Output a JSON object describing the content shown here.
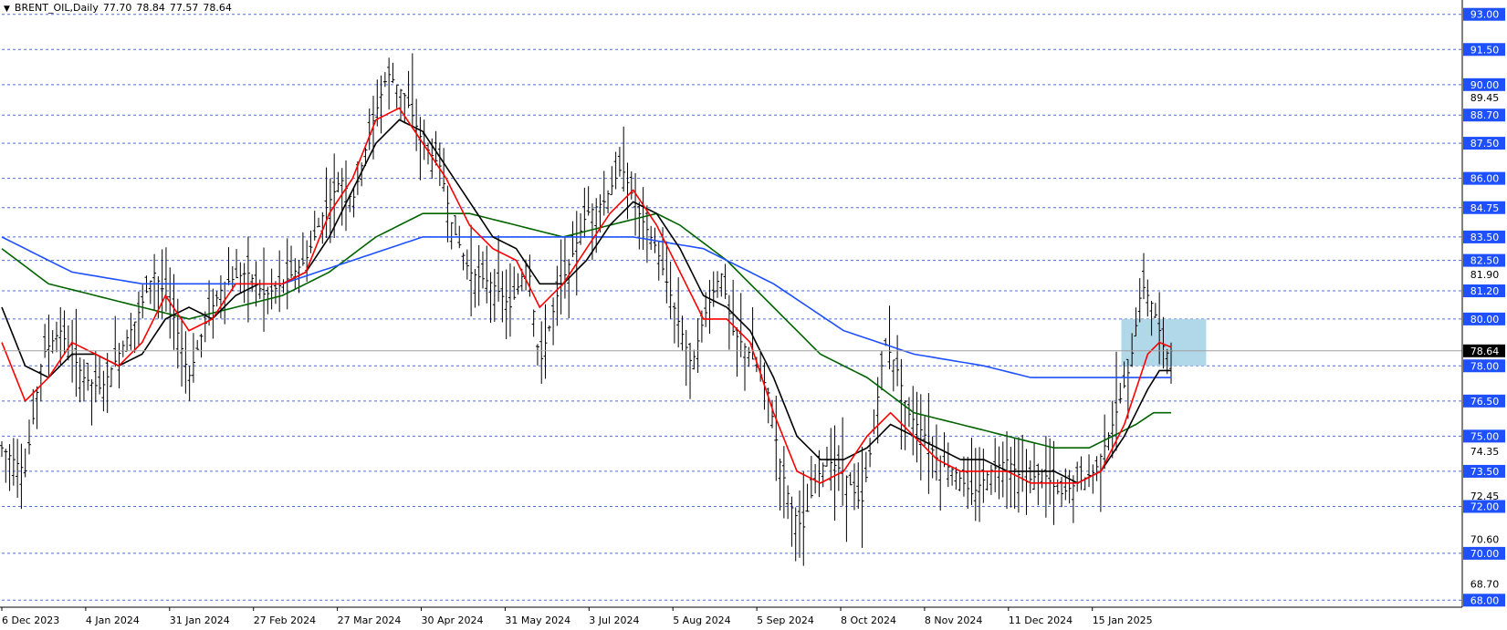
{
  "header": {
    "symbol": "BRENT_OIL,Daily",
    "open": "77.70",
    "high": "78.84",
    "low": "77.57",
    "close": "78.64"
  },
  "colors": {
    "grid": "#3355cc",
    "price": "#000000",
    "ma_fast": "#ff0000",
    "ma_mid": "#000000",
    "ma_long": "#006400",
    "ma_200": "#1e50ff",
    "zone": "#a8d4e6",
    "current_line": "#a0a0a0",
    "label_bg": "#1e50ff"
  },
  "chart_data": {
    "type": "line",
    "title": "",
    "y_range": [
      67.7,
      93.3
    ],
    "level_labels": [
      {
        "v": 93.0,
        "text": "93.00",
        "dash": true
      },
      {
        "v": 91.5,
        "text": "91.50",
        "dash": true
      },
      {
        "v": 90.0,
        "text": "90.00",
        "dash": true
      },
      {
        "v": 89.45,
        "text": "89.45",
        "dash": false
      },
      {
        "v": 88.7,
        "text": "88.70",
        "dash": true
      },
      {
        "v": 87.5,
        "text": "87.50",
        "dash": true
      },
      {
        "v": 86.0,
        "text": "86.00",
        "dash": true
      },
      {
        "v": 84.75,
        "text": "84.75",
        "dash": true
      },
      {
        "v": 83.5,
        "text": "83.50",
        "dash": true
      },
      {
        "v": 82.5,
        "text": "82.50",
        "dash": true
      },
      {
        "v": 81.9,
        "text": "81.90",
        "dash": false
      },
      {
        "v": 81.2,
        "text": "81.20",
        "dash": true
      },
      {
        "v": 80.0,
        "text": "80.00",
        "dash": true
      },
      {
        "v": 78.0,
        "text": "78.00",
        "dash": true
      },
      {
        "v": 76.5,
        "text": "76.50",
        "dash": true
      },
      {
        "v": 75.0,
        "text": "75.00",
        "dash": true
      },
      {
        "v": 74.35,
        "text": "74.35",
        "dash": false
      },
      {
        "v": 73.5,
        "text": "73.50",
        "dash": true
      },
      {
        "v": 72.45,
        "text": "72.45",
        "dash": false
      },
      {
        "v": 72.0,
        "text": "72.00",
        "dash": true
      },
      {
        "v": 70.6,
        "text": "70.60",
        "dash": false
      },
      {
        "v": 70.0,
        "text": "70.00",
        "dash": true
      },
      {
        "v": 68.7,
        "text": "68.70",
        "dash": false
      },
      {
        "v": 68.0,
        "text": "68.00",
        "dash": true
      }
    ],
    "current_price": {
      "v": 78.64,
      "text": "78.64"
    },
    "x_labels": [
      "6 Dec 2023",
      "4 Jan 2024",
      "31 Jan 2024",
      "27 Feb 2024",
      "27 Mar 2024",
      "30 Apr 2024",
      "31 May 2024",
      "3 Jul 2024",
      "5 Aug 2024",
      "5 Sep 2024",
      "8 Oct 2024",
      "8 Nov 2024",
      "11 Dec 2024",
      "15 Jan 2025"
    ],
    "zone": {
      "x_from": 0.9575,
      "x_to": 1.03,
      "y_low": 78.0,
      "y_high": 80.0
    },
    "price_knots": [
      [
        0,
        74.5
      ],
      [
        0.02,
        73.5
      ],
      [
        0.035,
        78.5
      ],
      [
        0.05,
        79.5
      ],
      [
        0.07,
        77.5
      ],
      [
        0.085,
        77.0
      ],
      [
        0.1,
        78.5
      ],
      [
        0.115,
        80.0
      ],
      [
        0.13,
        82.0
      ],
      [
        0.145,
        80.5
      ],
      [
        0.16,
        77.5
      ],
      [
        0.175,
        80.0
      ],
      [
        0.19,
        81.5
      ],
      [
        0.21,
        82.0
      ],
      [
        0.225,
        81.0
      ],
      [
        0.24,
        81.5
      ],
      [
        0.26,
        82.5
      ],
      [
        0.275,
        84.5
      ],
      [
        0.29,
        86.0
      ],
      [
        0.3,
        85.0
      ],
      [
        0.315,
        88.0
      ],
      [
        0.33,
        90.5
      ],
      [
        0.345,
        89.5
      ],
      [
        0.36,
        87.5
      ],
      [
        0.375,
        86.5
      ],
      [
        0.385,
        84.0
      ],
      [
        0.4,
        82.0
      ],
      [
        0.42,
        81.5
      ],
      [
        0.435,
        80.5
      ],
      [
        0.45,
        82.5
      ],
      [
        0.46,
        78.0
      ],
      [
        0.475,
        81.0
      ],
      [
        0.49,
        83.0
      ],
      [
        0.5,
        84.5
      ],
      [
        0.515,
        85.0
      ],
      [
        0.53,
        86.5
      ],
      [
        0.545,
        84.5
      ],
      [
        0.56,
        83.0
      ],
      [
        0.575,
        80.5
      ],
      [
        0.59,
        78.0
      ],
      [
        0.6,
        80.0
      ],
      [
        0.615,
        82.0
      ],
      [
        0.625,
        79.5
      ],
      [
        0.64,
        78.5
      ],
      [
        0.655,
        77.0
      ],
      [
        0.665,
        74.0
      ],
      [
        0.675,
        72.0
      ],
      [
        0.685,
        71.0
      ],
      [
        0.695,
        73.0
      ],
      [
        0.705,
        74.0
      ],
      [
        0.72,
        73.5
      ],
      [
        0.735,
        72.0
      ],
      [
        0.745,
        75.0
      ],
      [
        0.755,
        79.0
      ],
      [
        0.765,
        78.0
      ],
      [
        0.775,
        76.0
      ],
      [
        0.79,
        75.0
      ],
      [
        0.8,
        74.0
      ],
      [
        0.815,
        73.5
      ],
      [
        0.83,
        72.5
      ],
      [
        0.845,
        73.5
      ],
      [
        0.86,
        74.0
      ],
      [
        0.875,
        73.0
      ],
      [
        0.89,
        73.5
      ],
      [
        0.905,
        72.5
      ],
      [
        0.92,
        73.0
      ],
      [
        0.935,
        73.5
      ],
      [
        0.95,
        75.5
      ],
      [
        0.965,
        78.0
      ],
      [
        0.975,
        81.5
      ],
      [
        0.985,
        80.5
      ],
      [
        0.995,
        78.5
      ],
      [
        1.0,
        78.64
      ]
    ],
    "ma_fast_knots": [
      [
        0,
        79.0
      ],
      [
        0.02,
        76.5
      ],
      [
        0.04,
        77.5
      ],
      [
        0.06,
        79.0
      ],
      [
        0.08,
        78.5
      ],
      [
        0.1,
        78.0
      ],
      [
        0.12,
        79.0
      ],
      [
        0.14,
        81.0
      ],
      [
        0.16,
        79.5
      ],
      [
        0.18,
        80.0
      ],
      [
        0.2,
        81.5
      ],
      [
        0.22,
        81.5
      ],
      [
        0.24,
        81.5
      ],
      [
        0.26,
        82.0
      ],
      [
        0.28,
        84.5
      ],
      [
        0.3,
        86.0
      ],
      [
        0.32,
        88.5
      ],
      [
        0.34,
        89.0
      ],
      [
        0.36,
        87.5
      ],
      [
        0.38,
        86.0
      ],
      [
        0.4,
        84.0
      ],
      [
        0.42,
        83.0
      ],
      [
        0.44,
        82.5
      ],
      [
        0.46,
        80.5
      ],
      [
        0.48,
        81.5
      ],
      [
        0.5,
        83.0
      ],
      [
        0.52,
        84.5
      ],
      [
        0.54,
        85.5
      ],
      [
        0.56,
        84.0
      ],
      [
        0.58,
        82.0
      ],
      [
        0.6,
        80.0
      ],
      [
        0.62,
        80.0
      ],
      [
        0.64,
        79.0
      ],
      [
        0.66,
        76.0
      ],
      [
        0.68,
        73.5
      ],
      [
        0.7,
        73.0
      ],
      [
        0.72,
        73.5
      ],
      [
        0.74,
        75.0
      ],
      [
        0.76,
        76.0
      ],
      [
        0.78,
        75.0
      ],
      [
        0.8,
        74.0
      ],
      [
        0.82,
        73.5
      ],
      [
        0.84,
        73.5
      ],
      [
        0.86,
        73.5
      ],
      [
        0.88,
        73.0
      ],
      [
        0.9,
        73.0
      ],
      [
        0.92,
        73.0
      ],
      [
        0.94,
        73.5
      ],
      [
        0.96,
        75.5
      ],
      [
        0.98,
        78.5
      ],
      [
        0.99,
        79.0
      ],
      [
        1.0,
        78.8
      ]
    ],
    "ma_mid_knots": [
      [
        0,
        80.5
      ],
      [
        0.02,
        78.0
      ],
      [
        0.04,
        77.5
      ],
      [
        0.06,
        78.5
      ],
      [
        0.08,
        78.5
      ],
      [
        0.1,
        78.0
      ],
      [
        0.12,
        78.5
      ],
      [
        0.14,
        80.0
      ],
      [
        0.16,
        80.5
      ],
      [
        0.18,
        80.0
      ],
      [
        0.2,
        81.0
      ],
      [
        0.22,
        81.5
      ],
      [
        0.24,
        81.5
      ],
      [
        0.26,
        82.0
      ],
      [
        0.28,
        83.5
      ],
      [
        0.3,
        85.5
      ],
      [
        0.32,
        87.5
      ],
      [
        0.34,
        88.5
      ],
      [
        0.36,
        88.0
      ],
      [
        0.38,
        86.5
      ],
      [
        0.4,
        85.0
      ],
      [
        0.42,
        83.5
      ],
      [
        0.44,
        83.0
      ],
      [
        0.46,
        81.5
      ],
      [
        0.48,
        81.5
      ],
      [
        0.5,
        82.5
      ],
      [
        0.52,
        84.0
      ],
      [
        0.54,
        85.0
      ],
      [
        0.56,
        84.5
      ],
      [
        0.58,
        83.0
      ],
      [
        0.6,
        81.0
      ],
      [
        0.62,
        80.5
      ],
      [
        0.64,
        79.5
      ],
      [
        0.66,
        77.5
      ],
      [
        0.68,
        75.0
      ],
      [
        0.7,
        74.0
      ],
      [
        0.72,
        74.0
      ],
      [
        0.74,
        74.5
      ],
      [
        0.76,
        75.5
      ],
      [
        0.78,
        75.0
      ],
      [
        0.8,
        74.5
      ],
      [
        0.82,
        74.0
      ],
      [
        0.84,
        74.0
      ],
      [
        0.86,
        73.5
      ],
      [
        0.88,
        73.5
      ],
      [
        0.9,
        73.5
      ],
      [
        0.92,
        73.0
      ],
      [
        0.94,
        73.5
      ],
      [
        0.96,
        75.0
      ],
      [
        0.98,
        77.0
      ],
      [
        0.99,
        77.8
      ],
      [
        1.0,
        77.8
      ]
    ],
    "ma_long_knots": [
      [
        0,
        83.0
      ],
      [
        0.04,
        81.5
      ],
      [
        0.08,
        81.0
      ],
      [
        0.12,
        80.5
      ],
      [
        0.16,
        80.0
      ],
      [
        0.2,
        80.5
      ],
      [
        0.24,
        81.0
      ],
      [
        0.28,
        82.0
      ],
      [
        0.32,
        83.5
      ],
      [
        0.36,
        84.5
      ],
      [
        0.4,
        84.5
      ],
      [
        0.44,
        84.0
      ],
      [
        0.48,
        83.5
      ],
      [
        0.52,
        84.0
      ],
      [
        0.56,
        84.5
      ],
      [
        0.58,
        84.0
      ],
      [
        0.62,
        82.5
      ],
      [
        0.66,
        80.5
      ],
      [
        0.7,
        78.5
      ],
      [
        0.74,
        77.5
      ],
      [
        0.78,
        76.0
      ],
      [
        0.82,
        75.5
      ],
      [
        0.86,
        75.0
      ],
      [
        0.9,
        74.5
      ],
      [
        0.93,
        74.5
      ],
      [
        0.95,
        75.0
      ],
      [
        0.97,
        75.5
      ],
      [
        0.985,
        76.0
      ],
      [
        1.0,
        76.0
      ]
    ],
    "ma_200_knots": [
      [
        0,
        83.5
      ],
      [
        0.06,
        82.0
      ],
      [
        0.12,
        81.5
      ],
      [
        0.18,
        81.5
      ],
      [
        0.24,
        81.5
      ],
      [
        0.3,
        82.5
      ],
      [
        0.36,
        83.5
      ],
      [
        0.42,
        83.5
      ],
      [
        0.48,
        83.5
      ],
      [
        0.54,
        83.5
      ],
      [
        0.6,
        83.0
      ],
      [
        0.66,
        81.5
      ],
      [
        0.72,
        79.5
      ],
      [
        0.78,
        78.5
      ],
      [
        0.84,
        78.0
      ],
      [
        0.88,
        77.5
      ],
      [
        0.92,
        77.5
      ],
      [
        0.95,
        77.5
      ],
      [
        0.97,
        77.5
      ],
      [
        1.0,
        77.5
      ]
    ]
  }
}
